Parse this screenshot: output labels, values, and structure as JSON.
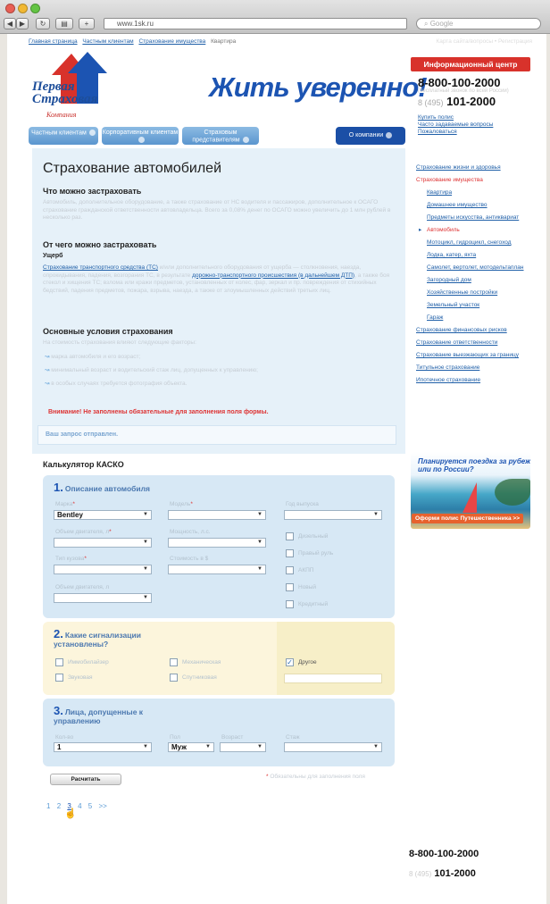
{
  "browser": {
    "url": "www.1sk.ru",
    "search_placeholder": "Google"
  },
  "breadcrumbs": [
    "Главная страница",
    "Частным клиентам",
    "Страхование имущества"
  ],
  "breadcrumb_current": "Квартира",
  "toplinks": "Карта сайта/вопросы • Регистрация",
  "logo": {
    "line1": "Первая",
    "line2": "Страховая",
    "line3": "Компания"
  },
  "slogan": "Жить уверенно!",
  "tabs": [
    "Частным клиентам",
    "Корпоративным клиентам",
    "Страховым представителям"
  ],
  "about_tab": "О компании",
  "info_center": {
    "title": "Информационный центр",
    "phone1": "8-800-100-2000",
    "phone_note": "(бесплатный звонок по всей России)",
    "phone2_code": "8 (495)",
    "phone2": "101-2000",
    "links": [
      "Купить полис",
      "Часто задаваемые вопросы",
      "Пожаловаться"
    ]
  },
  "content": {
    "title": "Страхование автомобилей",
    "s1_title": "Что можно застраховать",
    "s1_text": "Автомобиль, дополнительное оборудование, а также страхование от НС водителя и пассажиров, дополнительное к ОСАГО страхование гражданской ответственности автовладельца. Всего за 0,08% денег по ОСАГО можно увеличить до 1 млн рублей в несколько раз.",
    "s2_title": "От чего можно застраховать",
    "s2_sub": "Ущерб",
    "s2_link1": "Страхование транспортного средства (ТС)",
    "s2_text_a": " и/или дополнительного оборудования от ущерба — столкновения, наезда, опрокидывания, падения, возгорания ТС, в результате ",
    "s2_link2": "дорожно-транспортного происшествия (в дальнейшем ДТП)",
    "s2_text_b": ", а также боя стекол и хищения ТС; взлома или кражи предметов, установленных от колес, фар, зеркал и пр. повреждения от стихийных бедствий, падения предметов, пожара, взрыва, наезда, а также от злоумышленных действий третьих лиц.",
    "s3_title": "Основные условия страхования",
    "s3_intro": "На стоимость страхования влияют следующие факторы:",
    "s3_bullets": [
      "марка автомобиля и его возраст;",
      "минимальный возраст и водительский стаж лиц, допущенных к управлению;",
      "в особых случаях требуется фотография объекта."
    ],
    "warning": "Внимание! Не заполнены обязательные для заполнения поля формы.",
    "notice": "Ваш запрос отправлен."
  },
  "sidebar": {
    "items": [
      {
        "label": "Страхование жизни и здоровья",
        "level": 0,
        "state": ""
      },
      {
        "label": "Страхование имущества",
        "level": 0,
        "state": "cur"
      },
      {
        "label": "Квартира",
        "level": 1,
        "state": ""
      },
      {
        "label": "Домашнее имущество",
        "level": 1,
        "state": ""
      },
      {
        "label": "Предметы искусства, антиквариат",
        "level": 1,
        "state": ""
      },
      {
        "label": "Автомобиль",
        "level": 1,
        "state": "active"
      },
      {
        "label": "Мотоцикл, гидроцикл, снегоход",
        "level": 1,
        "state": ""
      },
      {
        "label": "Лодка, катер, яхта",
        "level": 1,
        "state": ""
      },
      {
        "label": "Самолет, вертолет, мотодельтаплан",
        "level": 1,
        "state": ""
      },
      {
        "label": "Загородный дом",
        "level": 1,
        "state": ""
      },
      {
        "label": "Хозяйственные постройки",
        "level": 1,
        "state": ""
      },
      {
        "label": "Земельный участок",
        "level": 1,
        "state": ""
      },
      {
        "label": "Гараж",
        "level": 1,
        "state": ""
      },
      {
        "label": "Страхование финансовых рисков",
        "level": 0,
        "state": ""
      },
      {
        "label": "Страхование ответственности",
        "level": 0,
        "state": ""
      },
      {
        "label": "Страхование выезжающих за границу",
        "level": 0,
        "state": ""
      },
      {
        "label": "Титульное страхование",
        "level": 0,
        "state": ""
      },
      {
        "label": "Ипотечное страхование",
        "level": 0,
        "state": ""
      }
    ]
  },
  "banner": {
    "title": "Планируется поездка за рубеж или по России?",
    "button": "Оформи полис Путешественника >>"
  },
  "calculator": {
    "title": "Калькулятор КАСКО",
    "panel1": {
      "num": "1.",
      "title": "Описание автомобиля",
      "make_label": "Марка",
      "make_value": "Bentley",
      "model_label": "Модель",
      "year_label": "Год выпуска",
      "engine_label": "Объем двигателя, л",
      "power_label": "Мощность, л.с.",
      "type_label": "Тип кузова",
      "cost_label": "Стоимость в $",
      "engine2_label": "Объем двигателя, л",
      "checks": [
        "Дизельный",
        "Правый руль",
        "АКПП",
        "Новый",
        "Кредитный"
      ]
    },
    "panel2": {
      "num": "2.",
      "title": "Какие сигнализации установлены?",
      "checks": [
        {
          "label": "Иммобилайзер",
          "checked": false
        },
        {
          "label": "Механическая",
          "checked": false
        },
        {
          "label": "Другое",
          "checked": true
        },
        {
          "label": "Звуковая",
          "checked": false
        },
        {
          "label": "Спутниковая",
          "checked": false
        }
      ]
    },
    "panel3": {
      "num": "3.",
      "title": "Лица, допущенные к управлению",
      "count_label": "Кол-во",
      "count_value": "1",
      "sex_label": "Пол",
      "sex_value": "Муж",
      "age_label": "Возраст",
      "exp_label": "Стаж"
    },
    "submit": "Расчитать",
    "req_note": "Обязательны для заполнения поля"
  },
  "pager": [
    "1",
    "2",
    "3",
    "4",
    "5",
    ">>"
  ],
  "pager_current": "3",
  "footer": {
    "phone1": "8-800-100-2000",
    "phone2_code": "8 (495)",
    "phone2": "101-2000"
  }
}
